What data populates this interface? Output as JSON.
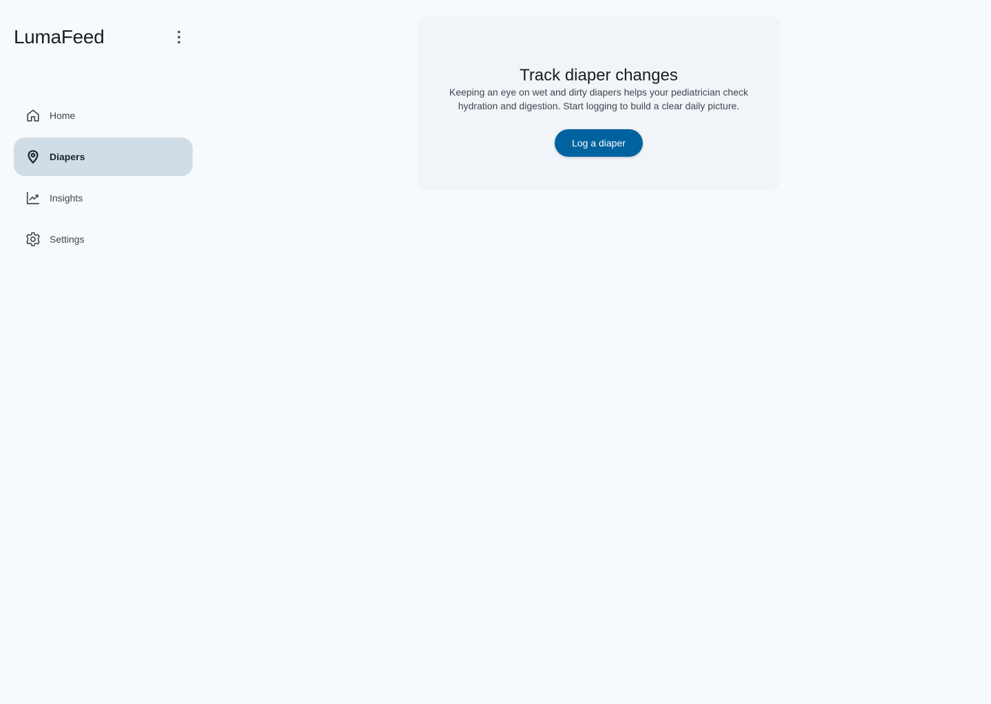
{
  "app": {
    "title": "LumaFeed"
  },
  "sidebar": {
    "items": [
      {
        "label": "Home",
        "icon": "home-icon",
        "active": false
      },
      {
        "label": "Diapers",
        "icon": "diaper-icon",
        "active": true
      },
      {
        "label": "Insights",
        "icon": "insights-chart-icon",
        "active": false
      },
      {
        "label": "Settings",
        "icon": "gear-icon",
        "active": false
      }
    ]
  },
  "main": {
    "card": {
      "title": "Track diaper changes",
      "description": "Keeping an eye on wet and dirty diapers helps your pediatrician check hydration and digestion. Start logging to build a clear daily picture.",
      "button_label": "Log a diaper"
    }
  },
  "colors": {
    "background": "#f7fafd",
    "active_nav": "#d0dde6",
    "card": "#f1f4f8",
    "primary": "#00629f"
  }
}
